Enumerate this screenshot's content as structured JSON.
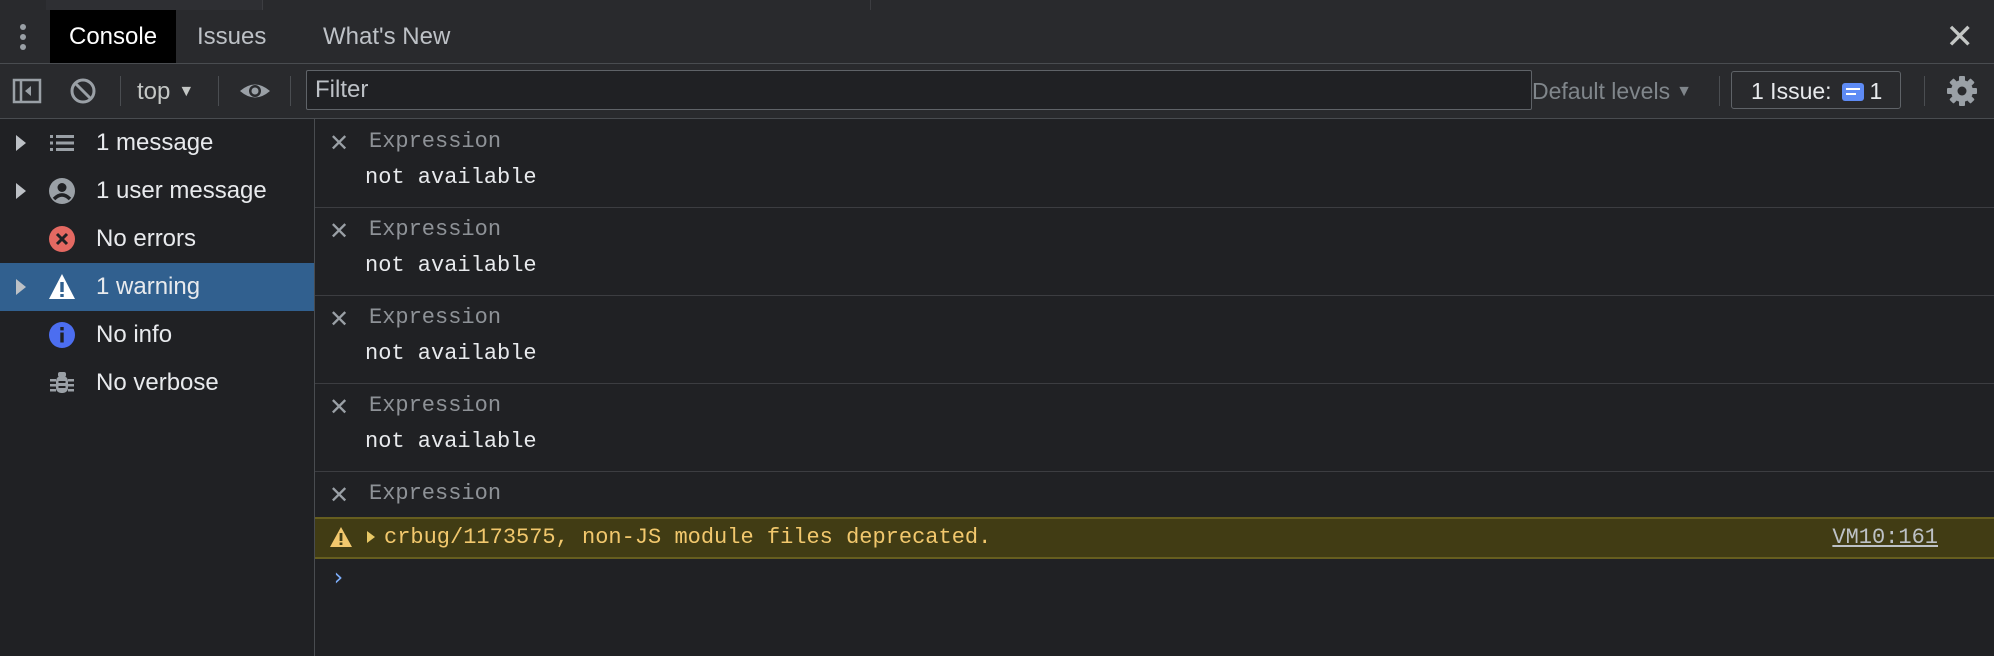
{
  "tabs": [
    {
      "label": "Console",
      "active": true
    },
    {
      "label": "Issues",
      "active": false
    },
    {
      "label": "What's New",
      "active": false
    }
  ],
  "toolbar": {
    "context": "top",
    "filter_placeholder": "Filter",
    "levels_label": "Default levels",
    "issues_label": "1 Issue:",
    "issues_count": "1"
  },
  "sidebar": {
    "items": [
      {
        "label": "1 message",
        "icon": "list-icon",
        "expandable": true,
        "selected": false
      },
      {
        "label": "1 user message",
        "icon": "user-circle-icon",
        "expandable": true,
        "selected": false
      },
      {
        "label": "No errors",
        "icon": "error-icon",
        "expandable": false,
        "selected": false
      },
      {
        "label": "1 warning",
        "icon": "warning-icon",
        "expandable": true,
        "selected": true
      },
      {
        "label": "No info",
        "icon": "info-icon",
        "expandable": false,
        "selected": false
      },
      {
        "label": "No verbose",
        "icon": "bug-icon",
        "expandable": false,
        "selected": false
      }
    ]
  },
  "console": {
    "expressions": [
      {
        "label": "Expression",
        "value": "not available"
      },
      {
        "label": "Expression",
        "value": "not available"
      },
      {
        "label": "Expression",
        "value": "not available"
      },
      {
        "label": "Expression",
        "value": "not available"
      },
      {
        "label": "Expression"
      }
    ],
    "warning": {
      "message": "crbug/1173575, non-JS module files deprecated.",
      "source": "VM10:161"
    },
    "prompt": "›"
  },
  "colors": {
    "background": "#202124",
    "toolbar": "#292a2d",
    "selected": "#31608f",
    "warning_bg": "#413c14",
    "warning_text": "#f2c86d",
    "accent": "#7cacf8",
    "error": "#e46962"
  }
}
